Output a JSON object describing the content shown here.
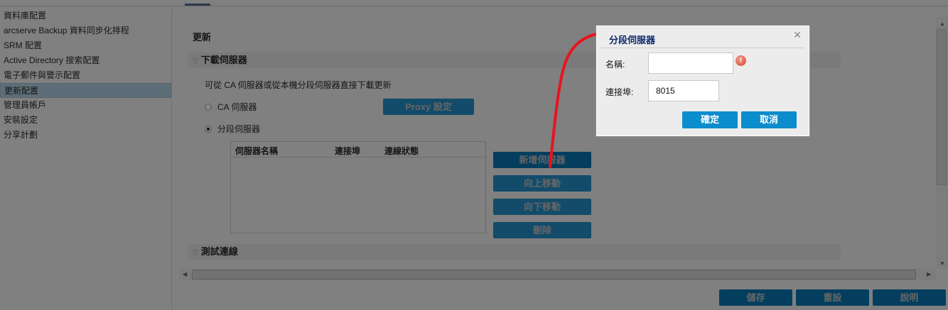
{
  "sidebar": {
    "items": [
      {
        "label": "資料庫配置"
      },
      {
        "label": "arcserve Backup 資料同步化排程"
      },
      {
        "label": "SRM 配置"
      },
      {
        "label": "Active Directory 搜索配置"
      },
      {
        "label": "電子郵件與警示配置"
      },
      {
        "label": "更新配置",
        "selected": true
      },
      {
        "label": "管理員帳戶"
      },
      {
        "label": "安裝設定"
      },
      {
        "label": "分享計劃"
      }
    ]
  },
  "main": {
    "title": "更新",
    "download_section": {
      "title": "下載伺服器",
      "description": "可從 CA 伺服器或從本機分段伺服器直接下載更新",
      "radio_ca": "CA 伺服器",
      "radio_staging": "分段伺服器",
      "proxy_button": "Proxy 設定",
      "table": {
        "columns": [
          "伺服器名稱",
          "連接埠",
          "連線狀態"
        ],
        "rows": []
      },
      "buttons": {
        "add": "新增伺服器",
        "move_up": "向上移動",
        "move_down": "向下移動",
        "delete": "刪除"
      }
    },
    "test_section": {
      "title": "測試連線"
    }
  },
  "footer": {
    "save": "儲存",
    "reset": "重設",
    "help": "說明"
  },
  "dialog": {
    "title": "分段伺服器",
    "name_label": "名稱:",
    "name_value": "",
    "port_label": "連接埠:",
    "port_value": "8015",
    "ok": "確定",
    "cancel": "取消"
  },
  "colors": {
    "accent": "#0b8ccc",
    "annotation": "#e8141e",
    "dialog_title": "#0e2a6a"
  }
}
